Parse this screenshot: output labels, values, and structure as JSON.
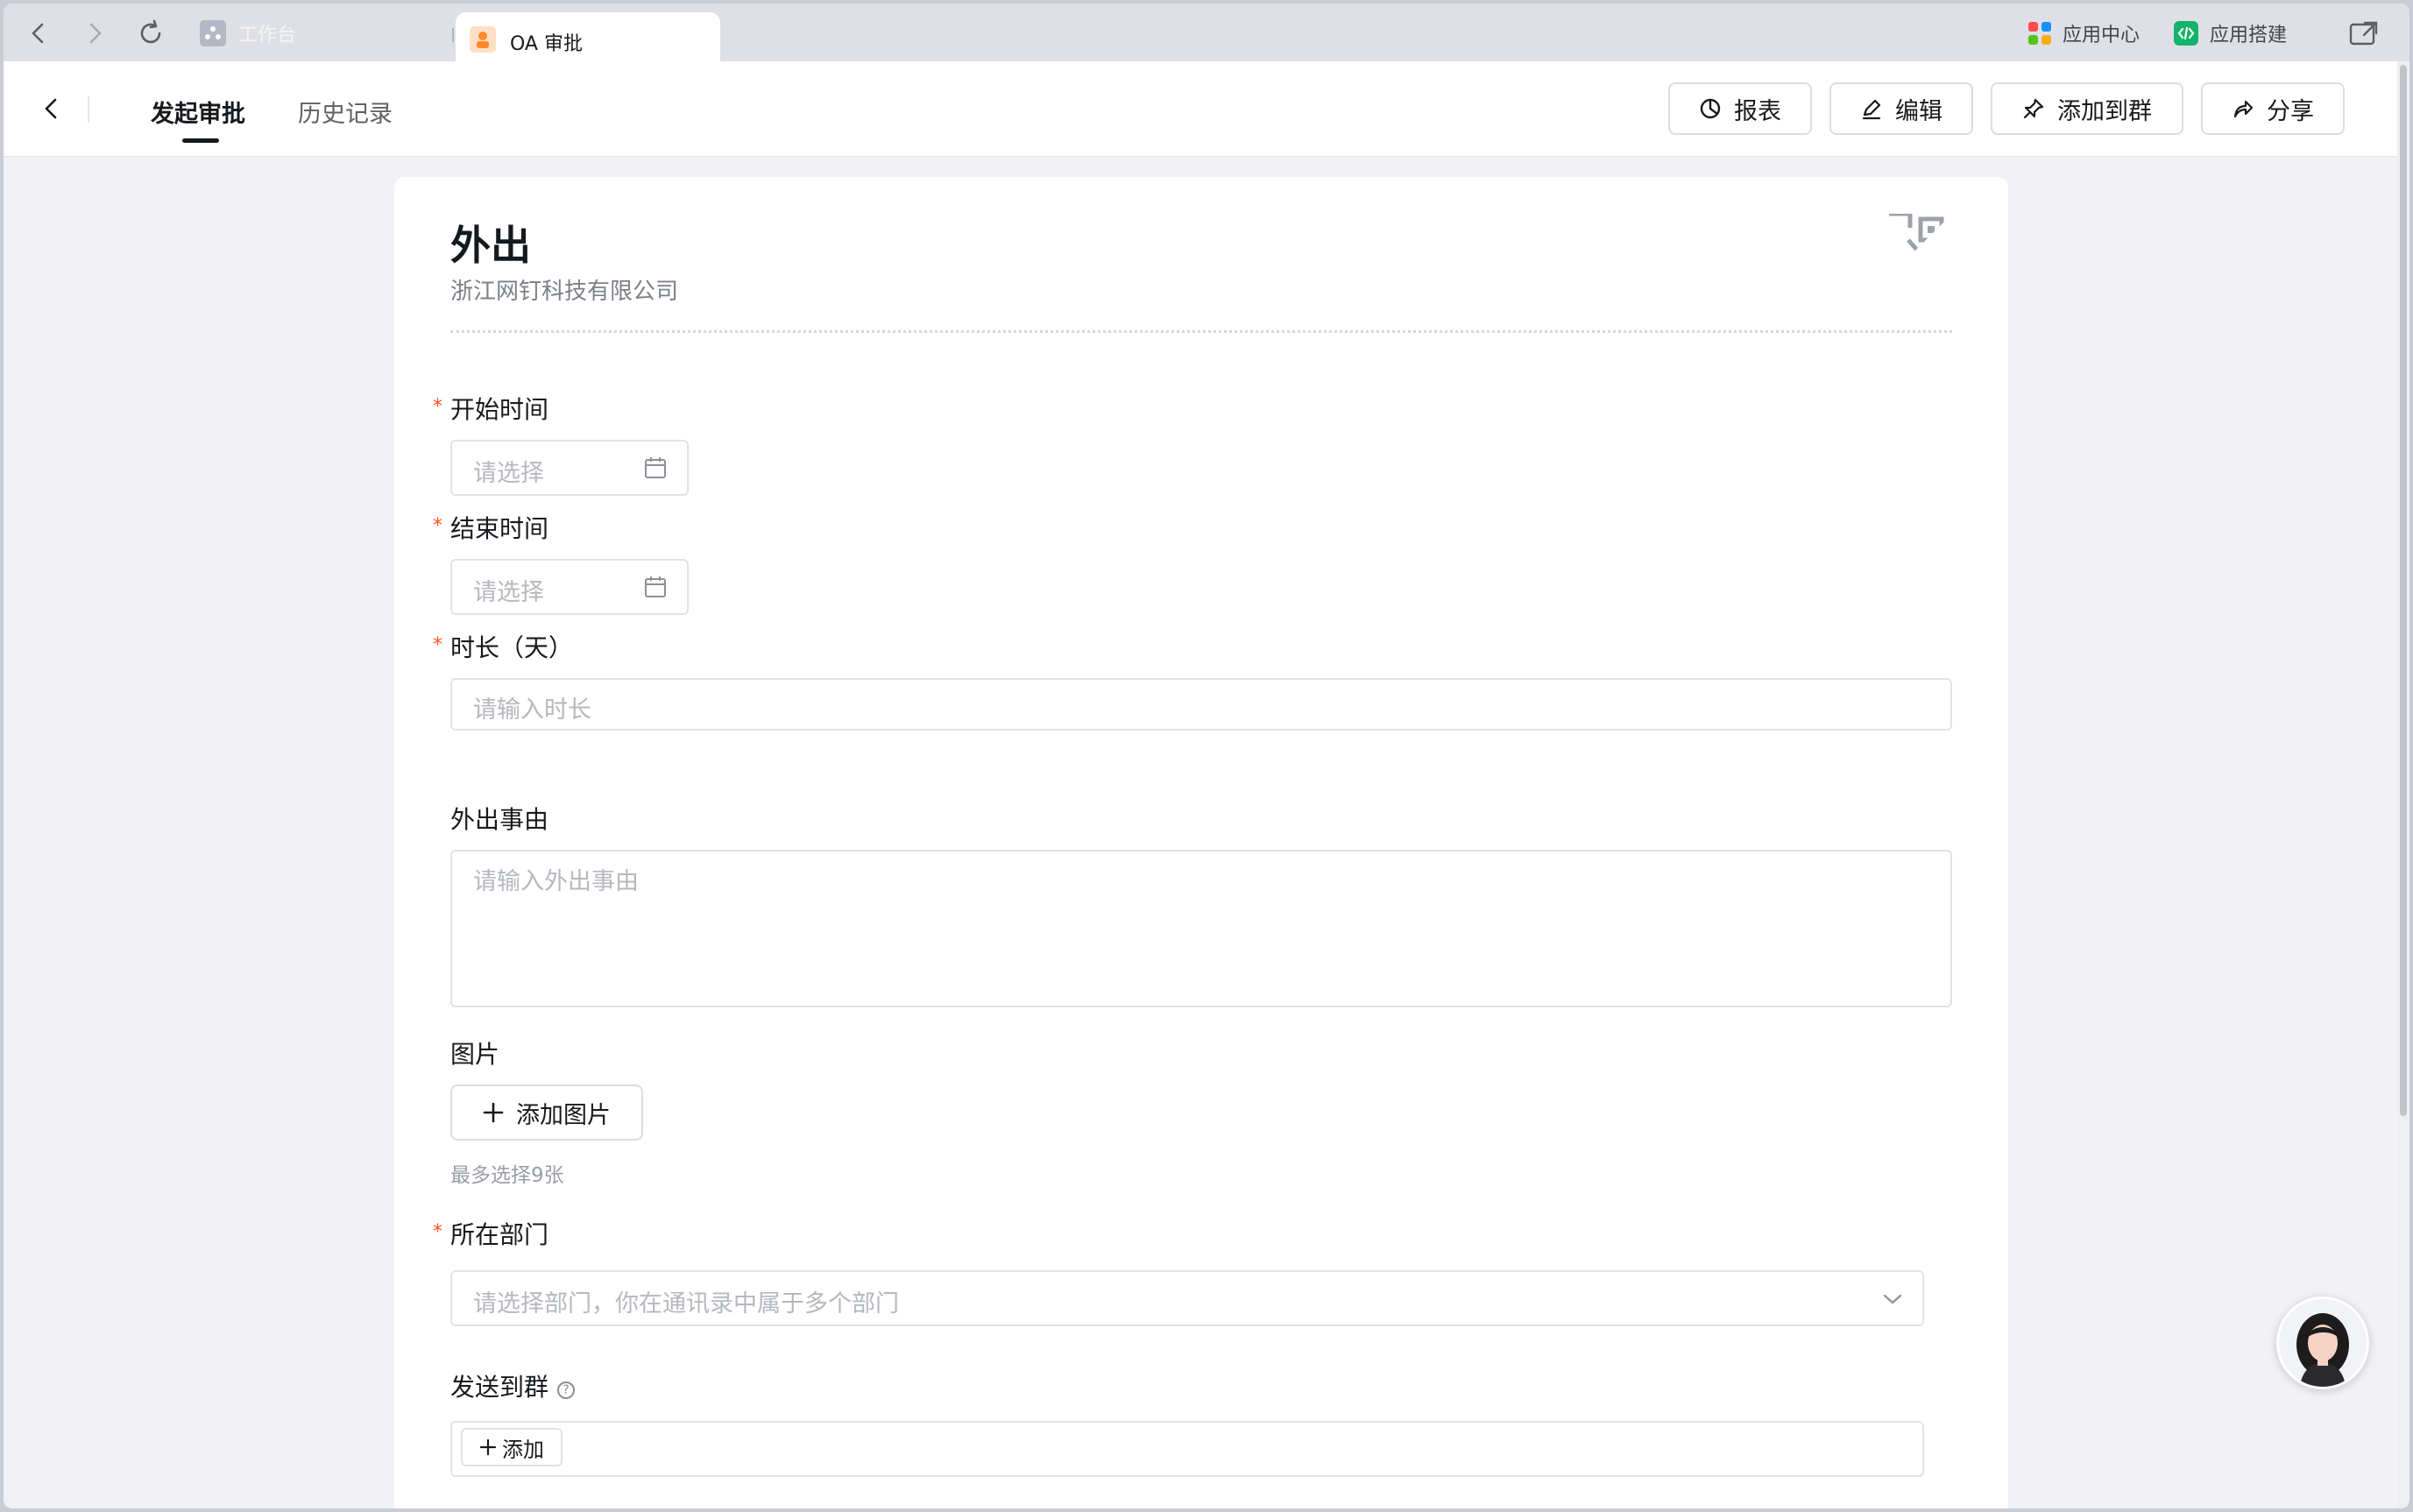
{
  "browser": {
    "inactive_tab_label": "工作台",
    "active_tab_label": "OA 审批",
    "app_center_label": "应用中心",
    "app_builder_label": "应用搭建"
  },
  "header": {
    "tabs": [
      {
        "label": "发起审批",
        "active": true
      },
      {
        "label": "历史记录",
        "active": false
      }
    ],
    "buttons": {
      "report": "报表",
      "edit": "编辑",
      "add_to_group": "添加到群",
      "share": "分享"
    }
  },
  "form": {
    "title": "外出",
    "company": "浙江网钉科技有限公司",
    "required_mark": "*",
    "fields": {
      "start_time": {
        "label": "开始时间",
        "placeholder": "请选择"
      },
      "end_time": {
        "label": "结束时间",
        "placeholder": "请选择"
      },
      "duration": {
        "label": "时长（天）",
        "placeholder": "请输入时长"
      },
      "reason": {
        "label": "外出事由",
        "placeholder": "请输入外出事由"
      },
      "images": {
        "label": "图片",
        "button": "添加图片",
        "hint": "最多选择9张"
      },
      "department": {
        "label": "所在部门",
        "placeholder": "请选择部门，你在通讯录中属于多个部门"
      },
      "send_to_group": {
        "label": "发送到群",
        "help": "?",
        "add_button": "添加"
      }
    }
  },
  "colors": {
    "required": "#ff5219",
    "placeholder": "#b5b8be",
    "page_bg": "#f2f2f6"
  }
}
